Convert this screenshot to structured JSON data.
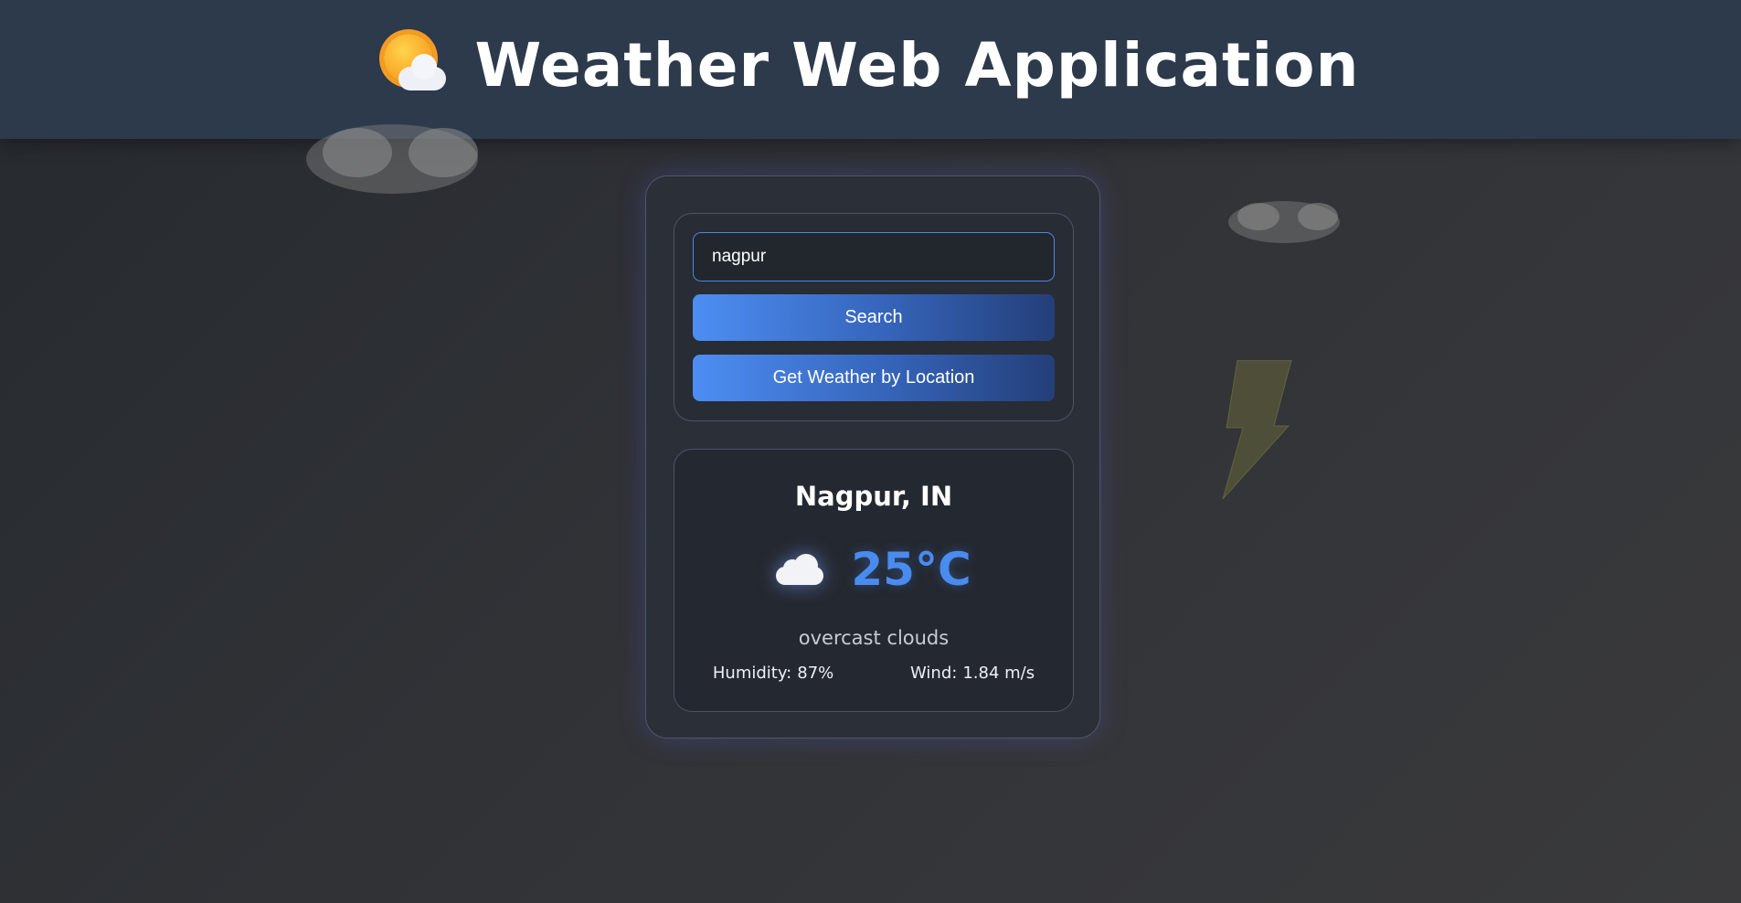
{
  "header": {
    "title": "Weather Web Application",
    "icon": "sun-behind-cloud-icon"
  },
  "search": {
    "value": "nagpur",
    "search_label": "Search",
    "location_label": "Get Weather by Location"
  },
  "weather": {
    "city": "Nagpur, IN",
    "icon": "cloud-icon",
    "temperature": "25°C",
    "description": "overcast clouds",
    "humidity_label": "Humidity:",
    "humidity_value": "87%",
    "wind_label": "Wind:",
    "wind_value": "1.84 m/s"
  },
  "colors": {
    "header_bg": "#2c3a4b",
    "accent": "#4a8bf0",
    "card_bg": "#2b2f37",
    "page_bg": "#303236"
  }
}
